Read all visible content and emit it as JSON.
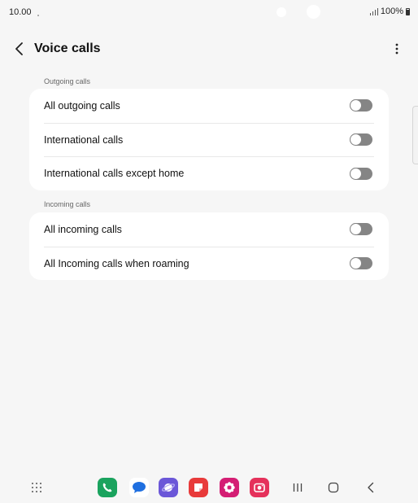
{
  "status_bar": {
    "time": "10.00",
    "battery_text": "100%"
  },
  "header": {
    "title": "Voice calls",
    "back_icon": "chevron-left-icon",
    "more_icon": "more-vertical-icon"
  },
  "sections": [
    {
      "label": "Outgoing calls",
      "items": [
        {
          "label": "All outgoing calls",
          "enabled": false
        },
        {
          "label": "International calls",
          "enabled": false
        },
        {
          "label": "International calls except home",
          "enabled": false
        }
      ]
    },
    {
      "label": "Incoming calls",
      "items": [
        {
          "label": "All incoming calls",
          "enabled": false
        },
        {
          "label": "All Incoming calls when roaming",
          "enabled": false
        }
      ]
    }
  ],
  "dock": {
    "apps": [
      {
        "name": "phone-app-icon",
        "color": "#1aa35e"
      },
      {
        "name": "messages-app-icon",
        "color": "#ffffff"
      },
      {
        "name": "internet-app-icon",
        "color": "#6b57d8"
      },
      {
        "name": "notes-app-icon",
        "color": "#e83a3a"
      },
      {
        "name": "gallery-app-icon",
        "color": "#d41e74"
      },
      {
        "name": "camera-app-icon",
        "color": "#e5315b"
      }
    ]
  },
  "colors": {
    "background": "#f6f6f6",
    "card": "#ffffff",
    "toggle_off": "#858585"
  }
}
